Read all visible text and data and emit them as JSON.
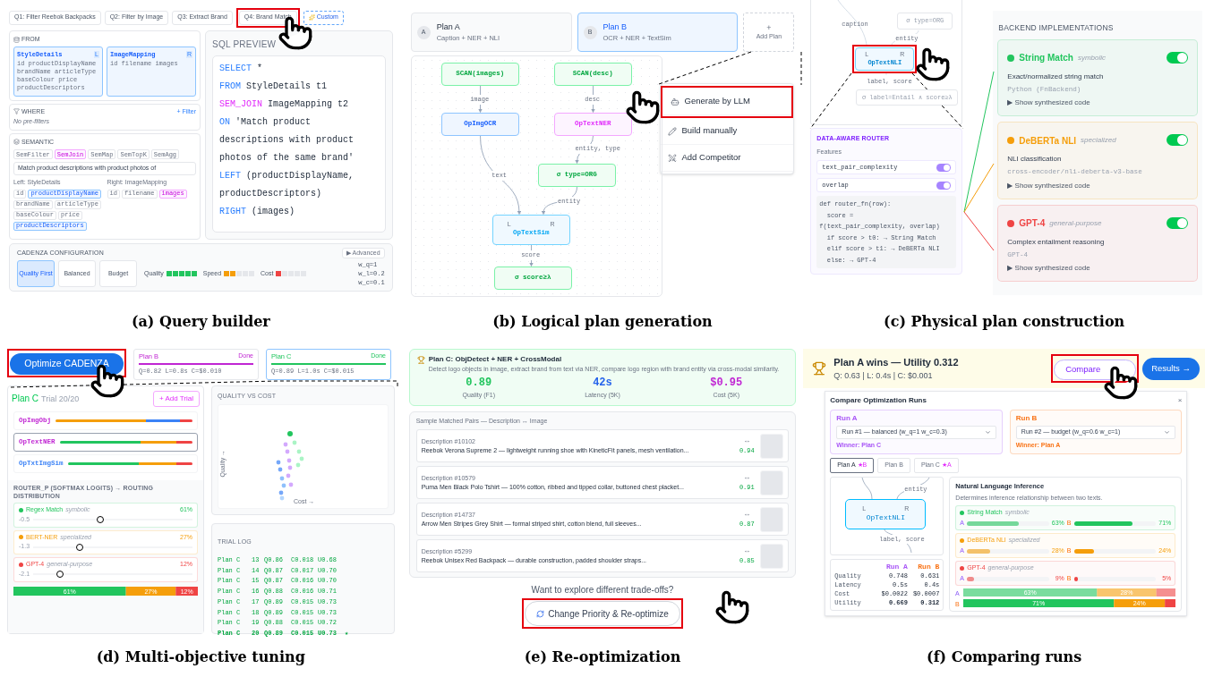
{
  "query_builder": {
    "caption": "(a) Query builder",
    "tabs": [
      {
        "label": "Q1: Filter Reebok Backpacks",
        "kind": "query",
        "selected": false,
        "highlighted": false
      },
      {
        "label": "Q2: Filter by Image",
        "kind": "query",
        "selected": false,
        "highlighted": false
      },
      {
        "label": "Q3: Extract Brand",
        "kind": "query",
        "selected": false,
        "highlighted": false
      },
      {
        "label": "Q4: Brand Match",
        "kind": "query",
        "selected": false,
        "highlighted": true
      },
      {
        "label": "Custom",
        "kind": "custom",
        "selected": false,
        "highlighted": false
      }
    ],
    "from": {
      "title": "FROM",
      "tables": [
        {
          "name": "StyleDetails",
          "side": "L",
          "fields": "id productDisplayName brandName articleType baseColour price productDescriptors"
        },
        {
          "name": "ImageMapping",
          "side": "R",
          "fields": "id filename images"
        }
      ]
    },
    "where": {
      "title": "WHERE",
      "action": "+ Filter",
      "empty_text": "No pre-filters"
    },
    "semantic": {
      "title": "SEMANTIC",
      "operators": [
        {
          "label": "SemFilter",
          "selected": false
        },
        {
          "label": "SemJoin",
          "selected": true
        },
        {
          "label": "SemMap",
          "selected": false
        },
        {
          "label": "SemTopK",
          "selected": false
        },
        {
          "label": "SemAgg",
          "selected": false
        }
      ],
      "prompt": "Match product descriptions with product photos of",
      "left": {
        "label": "Left: StyleDetails",
        "fields": [
          {
            "label": "id",
            "selected": false
          },
          {
            "label": "productDisplayName",
            "selected": true
          },
          {
            "label": "brandName",
            "selected": false
          },
          {
            "label": "articleType",
            "selected": false
          },
          {
            "label": "baseColour",
            "selected": false
          },
          {
            "label": "price",
            "selected": false
          },
          {
            "label": "productDescriptors",
            "selected": true
          }
        ]
      },
      "right": {
        "label": "Right: ImageMapping",
        "fields": [
          {
            "label": "id",
            "selected": false
          },
          {
            "label": "filename",
            "selected": false
          },
          {
            "label": "images",
            "selected": true
          }
        ]
      }
    },
    "sql": {
      "title": "SQL PREVIEW",
      "lines": [
        {
          "keyword": "SELECT",
          "kind": "clause",
          "text": "*"
        },
        {
          "keyword": "FROM",
          "kind": "clause",
          "text": "StyleDetails t1"
        },
        {
          "keyword": "SEM_JOIN",
          "kind": "semantic",
          "text": "ImageMapping t2"
        },
        {
          "keyword": "ON",
          "kind": "clause",
          "text": "'Match product"
        },
        {
          "text": "descriptions with product"
        },
        {
          "text": "photos of the same brand'"
        },
        {
          "keyword": "LEFT",
          "kind": "clause",
          "text": "(productDisplayName,"
        },
        {
          "text": "productDescriptors)"
        },
        {
          "keyword": "RIGHT",
          "kind": "clause",
          "text": "(images)"
        }
      ]
    },
    "config": {
      "title": "CADENZA CONFIGURATION",
      "advanced": "▶ Advanced",
      "presets": [
        {
          "label": "Quality First",
          "selected": true
        },
        {
          "label": "Balanced",
          "selected": false
        },
        {
          "label": "Budget",
          "selected": false
        }
      ],
      "meters": [
        {
          "label": "Quality",
          "level": 1,
          "color": "#22c55e"
        },
        {
          "label": "Speed",
          "level": 0.4,
          "color": "#f59e0b"
        },
        {
          "label": "Cost",
          "level": 0.2,
          "color": "#ef4444"
        }
      ],
      "weights": [
        "w_q=1",
        "w_l=0.2",
        "w_c=0.1"
      ]
    }
  },
  "logical_plan": {
    "caption": "(b) Logical plan generation",
    "plans": [
      {
        "badge": "A",
        "name": "Plan A",
        "description": "Caption + NER + NLI",
        "selected": false
      },
      {
        "badge": "B",
        "name": "Plan B",
        "description": "OCR + NER + TextSim",
        "selected": true
      }
    ],
    "add_plan": {
      "symbol": "+",
      "label": "Add Plan"
    },
    "nodes": [
      {
        "label": "SCAN(images)",
        "kind": "source"
      },
      {
        "label": "SCAN(desc)",
        "kind": "source"
      },
      {
        "label": "OpImgOCR",
        "kind": "image_model"
      },
      {
        "label": "OpTextNER",
        "kind": "text_model"
      },
      {
        "label": "σ type=ORG",
        "kind": "filter"
      },
      {
        "label": "OpTextSim",
        "kind": "join",
        "ports": [
          "L",
          "R"
        ]
      },
      {
        "label": "σ score≥λ",
        "kind": "filter"
      }
    ],
    "edges": [
      {
        "label": "image"
      },
      {
        "label": "desc"
      },
      {
        "label": "text"
      },
      {
        "label": "entity, type"
      },
      {
        "label": "entity"
      },
      {
        "label": "score"
      }
    ],
    "menu": [
      {
        "kind": "llm",
        "label": "Generate by LLM",
        "highlighted": true
      },
      {
        "kind": "manual",
        "label": "Build manually",
        "highlighted": false
      },
      {
        "kind": "competitor",
        "label": "Add Competitor",
        "highlighted": false
      }
    ]
  },
  "physical_plan": {
    "caption": "(c) Physical plan construction",
    "graph": {
      "edge_labels": [
        "caption",
        "entity",
        "label, score"
      ],
      "upper_node": "σ type=ORG",
      "node": {
        "label": "OpTextNLI",
        "ports": [
          "L",
          "R"
        ],
        "highlighted": true
      },
      "lower_node": "σ label=Entail ∧ score≥λ"
    },
    "router": {
      "title": "DATA-AWARE ROUTER",
      "features_label": "Features",
      "features": [
        {
          "name": "text_pair_complexity",
          "on": true
        },
        {
          "name": "overlap",
          "on": true
        }
      ],
      "code": [
        "def router_fn(row):",
        "  score =",
        "f(text_pair_complexity, overlap)",
        "  if score > t0: → String Match",
        "  elif score > t1: → DeBERTa NLI",
        "  else: → GPT-4"
      ]
    },
    "backends": {
      "title": "BACKEND IMPLEMENTATIONS",
      "items": [
        {
          "name": "String Match",
          "tag": "symbolic",
          "description": "Exact/normalized string match",
          "implementation": "Python (FnBackend)",
          "code_toggle": "▶ Show synthesized code",
          "on": true,
          "color": "#22c55e"
        },
        {
          "name": "DeBERTa NLI",
          "tag": "specialized",
          "description": "NLI classification",
          "implementation": "cross-encoder/nli-deberta-v3-base",
          "code_toggle": "▶ Show synthesized code",
          "on": true,
          "color": "#f59e0b"
        },
        {
          "name": "GPT-4",
          "tag": "general-purpose",
          "description": "Complex entailment reasoning",
          "implementation": "GPT-4",
          "code_toggle": "▶ Show synthesized code",
          "on": true,
          "color": "#ef4444"
        }
      ]
    }
  },
  "tuning": {
    "caption": "(d) Multi-objective tuning",
    "optimize_button": {
      "label": "Optimize CADENZA",
      "highlighted": true
    },
    "plan_cards": [
      {
        "name": "Plan B",
        "status": "Done",
        "stats": "Q=0.82 L=0.8s C=$0.010",
        "level": 1,
        "color": "#c026d3",
        "selected": false
      },
      {
        "name": "Plan C",
        "status": "Done",
        "stats": "Q=0.89 L=1.0s C=$0.015",
        "level": 1,
        "color": "#22c55e",
        "selected": true
      }
    ],
    "trial": {
      "plan": "Plan C",
      "progress": "Trial 20/20",
      "level": 1,
      "add_button": "+ Add Trial",
      "operators": [
        {
          "name": "OpImgObj",
          "color": "#c026d3",
          "selected": false
        },
        {
          "name": "OpTextNER",
          "color": "#c026d3",
          "selected": true
        },
        {
          "name": "OpTxtImgSim",
          "color": "#3b82f6",
          "selected": false
        }
      ]
    },
    "router": {
      "title": "ROUTER_P (SOFTMAX LOGITS) → ROUTING DISTRIBUTION",
      "items": [
        {
          "name": "Regex Match",
          "tag": "symbolic",
          "percent": "61%",
          "logit": "-0.5",
          "level": 0.42,
          "color": "#22c55e"
        },
        {
          "name": "BERT-NER",
          "tag": "specialized",
          "percent": "27%",
          "logit": "-1.3",
          "level": 0.29,
          "color": "#f59e0b"
        },
        {
          "name": "GPT-4",
          "tag": "general-purpose",
          "percent": "12%",
          "logit": "-2.1",
          "level": 0.17,
          "color": "#ef4444"
        }
      ],
      "chart_data": {
        "type": "bar",
        "stacked": true,
        "orientation": "horizontal",
        "xlim": [
          0,
          100
        ],
        "series": [
          {
            "color": "#22c55e",
            "values": [
              61
            ],
            "value_labels": [
              "61%"
            ]
          },
          {
            "color": "#f59e0b",
            "values": [
              27
            ],
            "value_labels": [
              "27%"
            ]
          },
          {
            "color": "#ef4444",
            "values": [
              12
            ],
            "value_labels": [
              "12%"
            ]
          }
        ]
      }
    },
    "scatter": {
      "title": "QUALITY VS COST",
      "xlabel": "Cost →",
      "ylabel": "Quality →"
    },
    "log": {
      "title": "TRIAL LOG",
      "rows": [
        {
          "cells": [
            "Plan C",
            "13",
            "Q0.86",
            "C0.018",
            "U0.68"
          ],
          "selected": false
        },
        {
          "cells": [
            "Plan C",
            "14",
            "Q0.87",
            "C0.017",
            "U0.70"
          ],
          "selected": false
        },
        {
          "cells": [
            "Plan C",
            "15",
            "Q0.87",
            "C0.016",
            "U0.70"
          ],
          "selected": false
        },
        {
          "cells": [
            "Plan C",
            "16",
            "Q0.88",
            "C0.016",
            "U0.71"
          ],
          "selected": false
        },
        {
          "cells": [
            "Plan C",
            "17",
            "Q0.89",
            "C0.015",
            "U0.73"
          ],
          "selected": false
        },
        {
          "cells": [
            "Plan C",
            "18",
            "Q0.89",
            "C0.015",
            "U0.73"
          ],
          "selected": false
        },
        {
          "cells": [
            "Plan C",
            "19",
            "Q0.88",
            "C0.015",
            "U0.72"
          ],
          "selected": false
        },
        {
          "cells": [
            "Plan C",
            "20",
            "Q0.89",
            "C0.015",
            "U0.73"
          ],
          "selected": true,
          "marker": "★"
        }
      ]
    }
  },
  "reoptimization": {
    "caption": "(e) Re-optimization",
    "summary": {
      "title": "Plan C: ObjDetect + NER + CrossModal",
      "description": "Detect logo objects in image, extract brand from text via NER, compare logo region with brand entity via cross-modal similarity.",
      "metrics": [
        {
          "value": "0.89",
          "label": "Quality (F1)",
          "color": "#22c55e"
        },
        {
          "value": "42s",
          "label": "Latency (5K)",
          "color": "#2563eb"
        },
        {
          "value": "$0.95",
          "label": "Cost (5K)",
          "color": "#c026d3"
        }
      ]
    },
    "samples": {
      "title": "Sample Matched Pairs — Description ↔ Image",
      "items": [
        {
          "id": "Description #10102",
          "text": "Reebok Verona Supreme 2 — lightweight running shoe with KineticFit panels, mesh ventilation...",
          "link": "↔",
          "score": "0.94"
        },
        {
          "id": "Description #10579",
          "text": "Puma Men Black Polo Tshirt — 100% cotton, ribbed and tipped collar, buttoned chest placket...",
          "link": "↔",
          "score": "0.91"
        },
        {
          "id": "Description #14737",
          "text": "Arrow Men Stripes Grey Shirt — formal striped shirt, cotton blend, full sleeves...",
          "link": "↔",
          "score": "0.87"
        },
        {
          "id": "Description #5299",
          "text": "Reebok Unisex Red Backpack — durable construction, padded shoulder straps...",
          "link": "↔",
          "score": "0.85"
        }
      ]
    },
    "prompt": "Want to explore different trade-offs?",
    "button": {
      "label": "Change Priority & Re-optimize",
      "highlighted": true
    }
  },
  "comparing_runs": {
    "caption": "(f) Comparing runs",
    "banner": {
      "title": "Plan A wins — Utility 0.312",
      "stats": "Q: 0.63 | L: 0.4s | C: $0.001",
      "compare": {
        "label": "Compare",
        "highlighted": true
      },
      "results": "Results →"
    },
    "modal": {
      "title": "Compare Optimization Runs",
      "close": "×",
      "runs": [
        {
          "label": "Run A",
          "value": "Run #1 — balanced (w_q=1 w_c=0.3)",
          "winner": "Winner: Plan C",
          "color": "#a855f7"
        },
        {
          "label": "Run B",
          "value": "Run #2 — budget (w_q=0.6 w_c=1)",
          "winner": "Winner: Plan A",
          "color": "#f97316"
        }
      ],
      "plan_tabs": [
        {
          "label": "Plan A",
          "badge": "★B",
          "selected": true
        },
        {
          "label": "Plan B",
          "selected": false
        },
        {
          "label": "Plan C",
          "badge": "★A",
          "selected": false
        }
      ],
      "graph": {
        "edge_labels": [
          "entity",
          "label, score"
        ],
        "node": {
          "label": "OpTextNLI",
          "ports": [
            "L",
            "R"
          ]
        }
      },
      "table": {
        "columns": [
          {
            "label": "Run A",
            "color": "#a855f7"
          },
          {
            "label": "Run B",
            "color": "#f97316"
          }
        ],
        "rows": [
          {
            "label": "Quality",
            "cells": [
              "0.748",
              "0.631"
            ],
            "emphasis": false
          },
          {
            "label": "Latency",
            "cells": [
              "0.5s",
              "0.4s"
            ],
            "emphasis": false
          },
          {
            "label": "Cost",
            "cells": [
              "$0.0022",
              "$0.0007"
            ],
            "emphasis": false
          },
          {
            "label": "Utility",
            "cells": [
              "0.669",
              "0.312"
            ],
            "emphasis": true
          }
        ]
      },
      "nli": {
        "title": "Natural Language Inference",
        "description": "Determines inference relationship between two texts.",
        "backends": [
          {
            "name": "String Match",
            "tag": "symbolic",
            "color": "#22c55e",
            "a": {
              "label": "A",
              "level": 0.63,
              "percent": "63%"
            },
            "b": {
              "label": "B",
              "level": 0.71,
              "percent": "71%"
            }
          },
          {
            "name": "DeBERTa NLI",
            "tag": "specialized",
            "color": "#f59e0b",
            "a": {
              "label": "A",
              "level": 0.28,
              "percent": "28%"
            },
            "b": {
              "label": "B",
              "level": 0.24,
              "percent": "24%"
            }
          },
          {
            "name": "GPT-4",
            "tag": "general-purpose",
            "color": "#ef4444",
            "a": {
              "label": "A",
              "level": 0.09,
              "percent": "9%"
            },
            "b": {
              "label": "B",
              "level": 0.05,
              "percent": "5%"
            }
          }
        ],
        "chart_data": {
          "type": "bar",
          "stacked": true,
          "orientation": "horizontal",
          "xlim": [
            0,
            100
          ],
          "categories": [
            "A",
            "B"
          ],
          "series": [
            {
              "color": "#22c55e",
              "values": [
                63,
                71
              ],
              "value_labels": [
                "63%",
                "71%"
              ]
            },
            {
              "color": "#f59e0b",
              "values": [
                28,
                24
              ],
              "value_labels": [
                "28%",
                "24%"
              ]
            },
            {
              "color": "#ef4444",
              "values": [
                9,
                5
              ]
            }
          ]
        }
      }
    }
  }
}
